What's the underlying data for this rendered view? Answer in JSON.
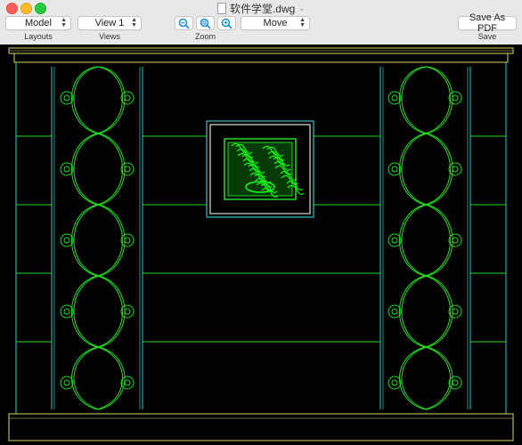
{
  "window": {
    "title": "软件学堂.dwg"
  },
  "toolbar": {
    "layouts": {
      "value": "Model",
      "caption": "Layouts"
    },
    "views": {
      "value": "View 1",
      "caption": "Views"
    },
    "zoom": {
      "caption": "Zoom",
      "buttons": [
        "zoom-out-icon",
        "zoom-fit-icon",
        "zoom-in-icon"
      ]
    },
    "tool": {
      "value": "Move"
    },
    "save": {
      "label": "Save As PDF",
      "caption": "Save"
    }
  },
  "canvas": {
    "background": "#000000",
    "colors": {
      "green": "#22dd22",
      "cyan": "#30c8c8",
      "yellow": "#d8d860",
      "panel_fill": "#10ff10"
    }
  }
}
